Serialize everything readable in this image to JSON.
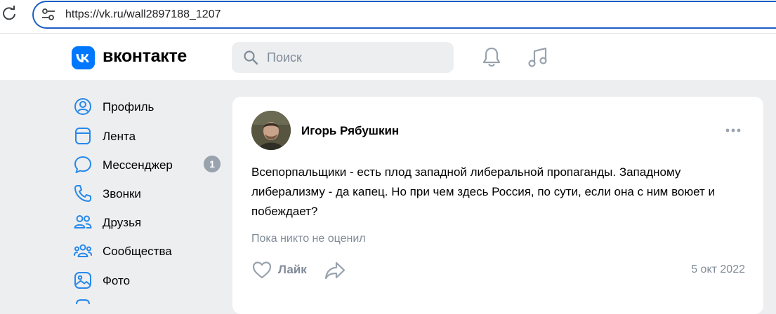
{
  "browser": {
    "url": "https://vk.ru/wall2897188_1207"
  },
  "header": {
    "logo_text": "вконтакте",
    "search_placeholder": "Поиск"
  },
  "sidebar": {
    "items": [
      {
        "label": "Профиль",
        "icon": "user-circle-icon"
      },
      {
        "label": "Лента",
        "icon": "newsfeed-icon"
      },
      {
        "label": "Мессенджер",
        "icon": "chat-bubble-icon",
        "badge": "1"
      },
      {
        "label": "Звонки",
        "icon": "phone-icon"
      },
      {
        "label": "Друзья",
        "icon": "friends-icon"
      },
      {
        "label": "Сообщества",
        "icon": "communities-icon"
      },
      {
        "label": "Фото",
        "icon": "photo-icon"
      }
    ]
  },
  "post": {
    "author": "Игорь Рябушкин",
    "text": "Всепорпальщики - есть плод западной либеральной пропаганды. Западному либерализму - да капец. Но при чем здесь Россия, по сути, если она с ним воюет и побеждает?",
    "likes_status": "Пока никто не оценил",
    "like_label": "Лайк",
    "date": "5 окт 2022"
  },
  "colors": {
    "accent": "#0077ff",
    "background": "#edeef0",
    "secondary_text": "#818c99",
    "address_border": "#1a5ec4"
  }
}
